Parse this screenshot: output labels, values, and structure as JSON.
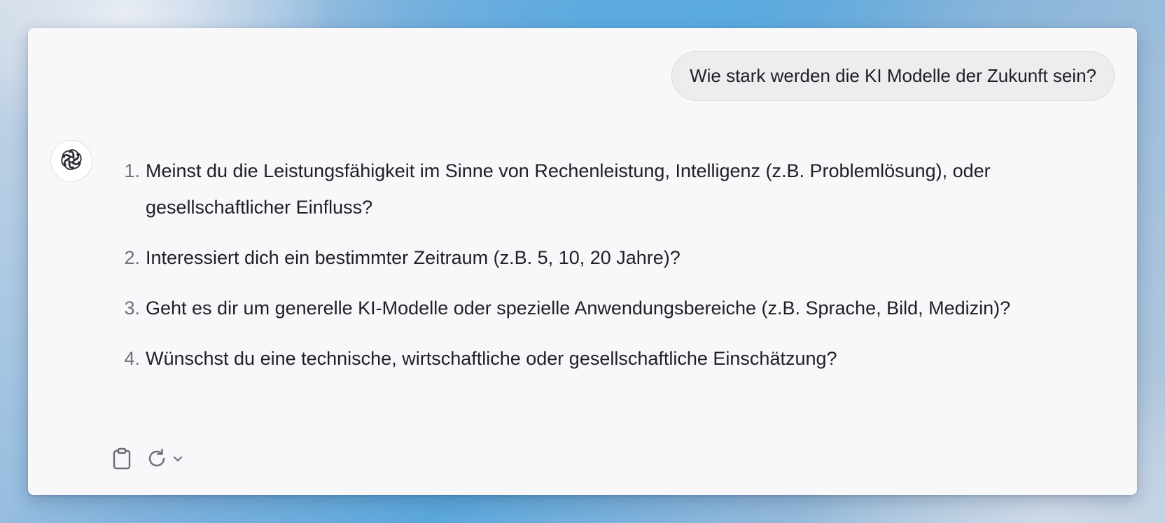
{
  "conversation": {
    "user_message": "Wie stark werden die KI Modelle der Zukunft sein?",
    "assistant": {
      "avatar_icon": "openai-logo-icon",
      "items": [
        {
          "number": "1.",
          "text": "Meinst du die Leistungsfähigkeit im Sinne von Rechenleistung, Intelligenz (z.B. Problemlösung), oder gesellschaftlicher Einfluss?"
        },
        {
          "number": "2.",
          "text": "Interessiert dich ein bestimmter Zeitraum (z.B. 5, 10, 20 Jahre)?"
        },
        {
          "number": "3.",
          "text": "Geht es dir um generelle KI-Modelle oder spezielle Anwendungsbereiche (z.B. Sprache, Bild, Medizin)?"
        },
        {
          "number": "4.",
          "text": "Wünschst du eine technische, wirtschaftliche oder gesellschaftliche Einschätzung?"
        }
      ]
    }
  },
  "toolbar": {
    "icons": [
      "clipboard-icon",
      "regenerate-icon",
      "chevron-down-icon"
    ]
  },
  "colors": {
    "window_background": "#f8f8fb",
    "user_bubble": "#ededf0",
    "text": "#1f1f24",
    "list_number": "#6f6f76",
    "icon": "#6b6b72"
  }
}
